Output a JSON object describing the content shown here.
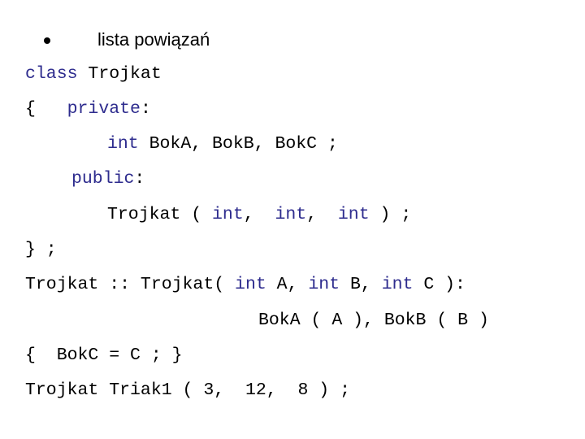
{
  "heading": {
    "bullet_icon": "bullet-dot",
    "text": "lista powiązań"
  },
  "code": {
    "l1": {
      "kw": "class",
      "rest": " Trojkat"
    },
    "l2": {
      "brace": "{   ",
      "kw": "private",
      "rest": ":"
    },
    "l3": {
      "kw": "int",
      "rest": " BokA, BokB, BokC ;"
    },
    "l4": {
      "kw": "public",
      "rest": ":"
    },
    "l5": {
      "a": "Trojkat ( ",
      "kw1": "int",
      "b": ",  ",
      "kw2": "int",
      "c": ",  ",
      "kw3": "int",
      "d": " ) ;"
    },
    "l6": {
      "text": "} ;"
    },
    "l7": {
      "a": "Trojkat :: Trojkat( ",
      "kw1": "int",
      "b": " A, ",
      "kw2": "int",
      "c": " B, ",
      "kw3": "int",
      "d": " C ):"
    },
    "l8": {
      "text": "BokA ( A ), BokB ( B )"
    },
    "l9": {
      "text": "{  BokC = C ; }"
    },
    "l10": {
      "text": "Trojkat Triak1 ( 3,  12,  8 ) ;"
    }
  },
  "colors": {
    "keyword": "#2e2c8e",
    "text": "#000000"
  }
}
